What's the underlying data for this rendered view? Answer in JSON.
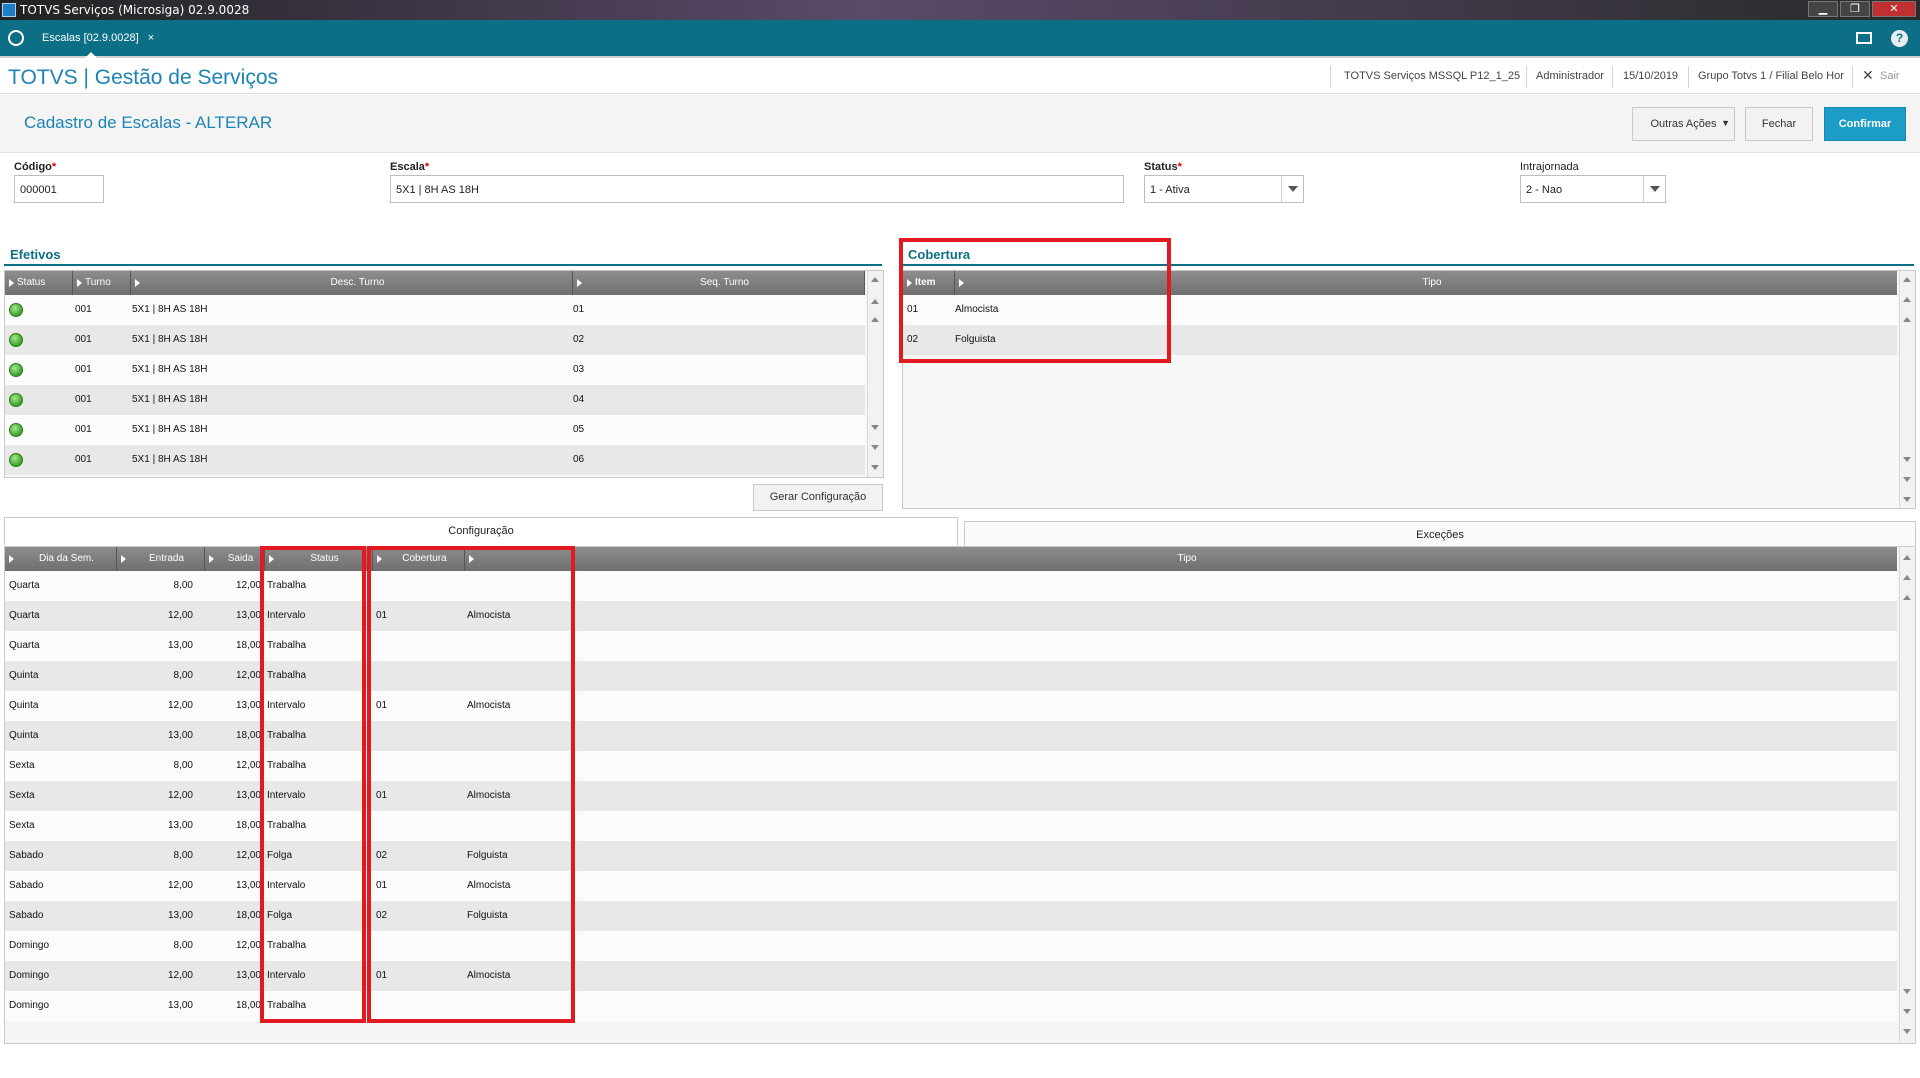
{
  "window": {
    "title": "TOTVS Serviços (Microsiga) 02.9.0028",
    "buttons": [
      "▁",
      "❐",
      "✕"
    ]
  },
  "tabbar": {
    "tab_label": "Escalas [02.9.0028]",
    "tab_close": "×",
    "help": "?"
  },
  "header": {
    "brand": "TOTVS | Gestão de Serviços",
    "environment": "TOTVS Serviços MSSQL P12_1_25",
    "user": "Administrador",
    "date": "15/10/2019",
    "branch": "Grupo Totvs 1 / Filial Belo Hor",
    "exit_label": "Sair"
  },
  "form": {
    "title": "Cadastro de Escalas - ALTERAR",
    "actions": {
      "other": "Outras Ações",
      "close": "Fechar",
      "confirm": "Confirmar"
    },
    "fields": {
      "codigo": {
        "label": "Código",
        "req": "*",
        "value": "000001"
      },
      "escala": {
        "label": "Escala",
        "req": "*",
        "value": "5X1 | 8H AS 18H"
      },
      "status": {
        "label": "Status",
        "req": "*",
        "value": "1 - Ativa"
      },
      "intrajornada": {
        "label": "Intrajornada",
        "value": "2 - Nao"
      }
    }
  },
  "efetivos": {
    "title": "Efetivos",
    "columns": [
      "Status",
      "Turno",
      "Desc. Turno",
      "Seq. Turno"
    ],
    "rows": [
      {
        "turno": "001",
        "desc": "5X1 | 8H AS 18H",
        "seq": "01"
      },
      {
        "turno": "001",
        "desc": "5X1 | 8H AS 18H",
        "seq": "02"
      },
      {
        "turno": "001",
        "desc": "5X1 | 8H AS 18H",
        "seq": "03"
      },
      {
        "turno": "001",
        "desc": "5X1 | 8H AS 18H",
        "seq": "04"
      },
      {
        "turno": "001",
        "desc": "5X1 | 8H AS 18H",
        "seq": "05"
      },
      {
        "turno": "001",
        "desc": "5X1 | 8H AS 18H",
        "seq": "06"
      }
    ],
    "button": "Gerar Configuração"
  },
  "cobertura": {
    "title": "Cobertura",
    "columns": [
      "Item",
      "Tipo"
    ],
    "rows": [
      {
        "item": "01",
        "tipo": "Almocista"
      },
      {
        "item": "02",
        "tipo": "Folguista"
      }
    ]
  },
  "panel_tabs": {
    "config": "Configuração",
    "excecoes": "Exceções"
  },
  "config": {
    "columns": [
      "Dia da Sem.",
      "Entrada",
      "Saida",
      "Status",
      "Cobertura",
      "Tipo"
    ],
    "rows": [
      {
        "dia": "Quarta",
        "entrada": "8,00",
        "saida": "12,00",
        "status": "Trabalha",
        "cobertura": "",
        "tipo": ""
      },
      {
        "dia": "Quarta",
        "entrada": "12,00",
        "saida": "13,00",
        "status": "Intervalo",
        "cobertura": "01",
        "tipo": "Almocista"
      },
      {
        "dia": "Quarta",
        "entrada": "13,00",
        "saida": "18,00",
        "status": "Trabalha",
        "cobertura": "",
        "tipo": ""
      },
      {
        "dia": "Quinta",
        "entrada": "8,00",
        "saida": "12,00",
        "status": "Trabalha",
        "cobertura": "",
        "tipo": ""
      },
      {
        "dia": "Quinta",
        "entrada": "12,00",
        "saida": "13,00",
        "status": "Intervalo",
        "cobertura": "01",
        "tipo": "Almocista"
      },
      {
        "dia": "Quinta",
        "entrada": "13,00",
        "saida": "18,00",
        "status": "Trabalha",
        "cobertura": "",
        "tipo": ""
      },
      {
        "dia": "Sexta",
        "entrada": "8,00",
        "saida": "12,00",
        "status": "Trabalha",
        "cobertura": "",
        "tipo": ""
      },
      {
        "dia": "Sexta",
        "entrada": "12,00",
        "saida": "13,00",
        "status": "Intervalo",
        "cobertura": "01",
        "tipo": "Almocista"
      },
      {
        "dia": "Sexta",
        "entrada": "13,00",
        "saida": "18,00",
        "status": "Trabalha",
        "cobertura": "",
        "tipo": ""
      },
      {
        "dia": "Sabado",
        "entrada": "8,00",
        "saida": "12,00",
        "status": "Folga",
        "cobertura": "02",
        "tipo": "Folguista"
      },
      {
        "dia": "Sabado",
        "entrada": "12,00",
        "saida": "13,00",
        "status": "Intervalo",
        "cobertura": "01",
        "tipo": "Almocista"
      },
      {
        "dia": "Sabado",
        "entrada": "13,00",
        "saida": "18,00",
        "status": "Folga",
        "cobertura": "02",
        "tipo": "Folguista"
      },
      {
        "dia": "Domingo",
        "entrada": "8,00",
        "saida": "12,00",
        "status": "Trabalha",
        "cobertura": "",
        "tipo": ""
      },
      {
        "dia": "Domingo",
        "entrada": "12,00",
        "saida": "13,00",
        "status": "Intervalo",
        "cobertura": "01",
        "tipo": "Almocista"
      },
      {
        "dia": "Domingo",
        "entrada": "13,00",
        "saida": "18,00",
        "status": "Trabalha",
        "cobertura": "",
        "tipo": ""
      }
    ]
  },
  "colors": {
    "accent": "#0d6f86",
    "brand": "#1b84b3",
    "confirm": "#1b9dc7",
    "highlight": "#e11a22"
  }
}
